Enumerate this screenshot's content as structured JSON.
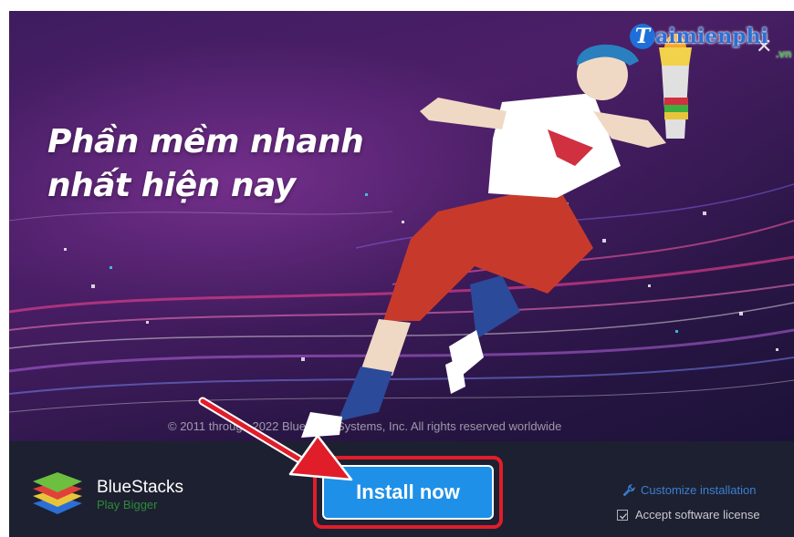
{
  "banner": {
    "headline_line1": "Phần mềm nhanh",
    "headline_line2": "nhất hiện nay",
    "copyright": "© 2011 through 2022 Bluestack Systems, Inc. All rights reserved worldwide"
  },
  "watermark": {
    "letter": "T",
    "text": "aimienphi",
    "suffix": ".vn"
  },
  "footer": {
    "brand_name": "BlueStacks",
    "brand_tagline": "Play Bigger",
    "install_label": "Install now",
    "customize_label": "Customize installation",
    "accept_label": "Accept software license",
    "accept_checked": true
  },
  "colors": {
    "install_button": "#1e90e8",
    "highlight": "#e11d2a",
    "footer_bg": "#1d2030",
    "link": "#3b7fd3",
    "tagline": "#2e8a3a"
  }
}
